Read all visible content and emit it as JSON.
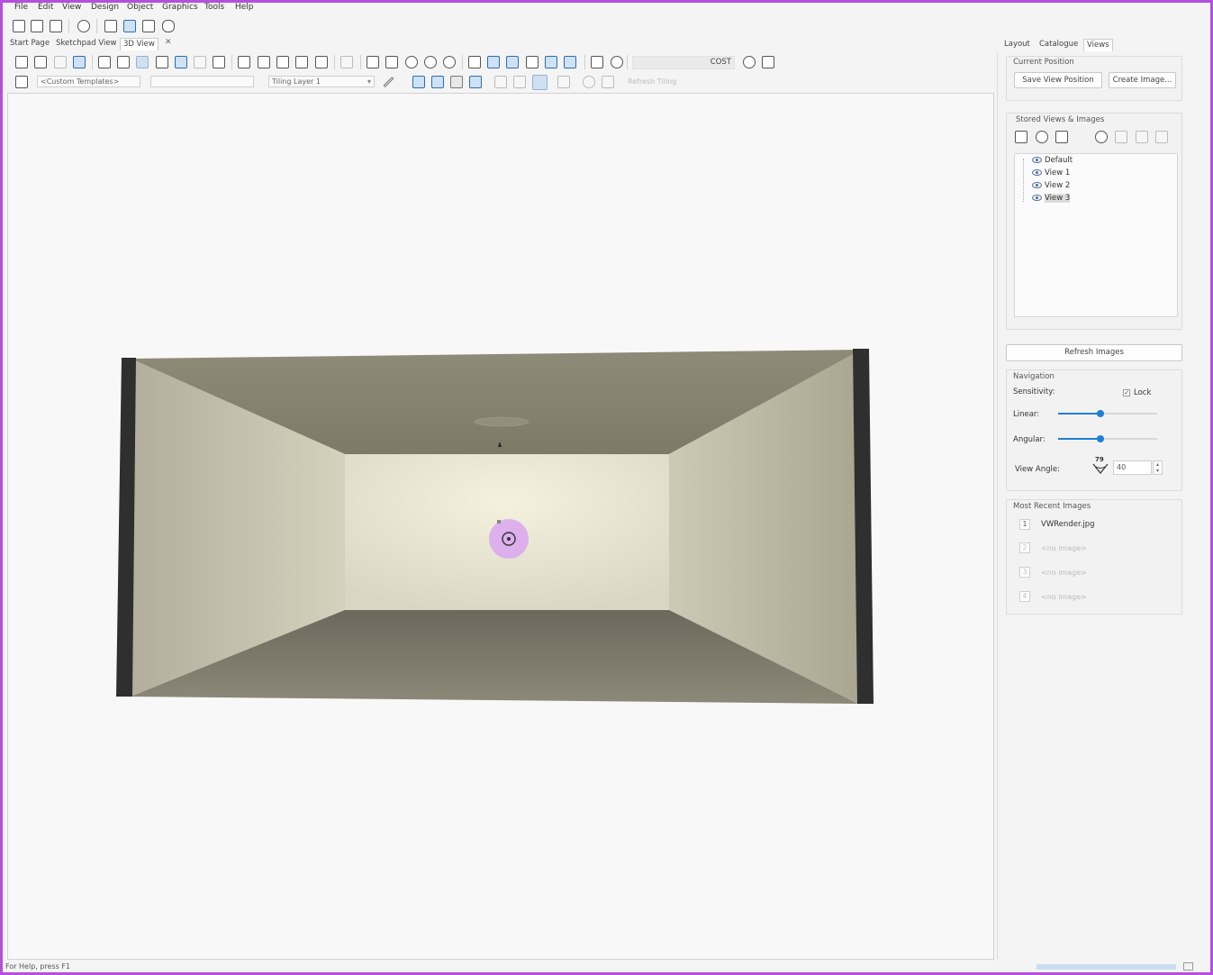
{
  "menu": [
    "File",
    "Edit",
    "View",
    "Design",
    "Object",
    "Graphics",
    "Tools",
    "Help"
  ],
  "doc_tabs": [
    "Start Page",
    "Sketchpad View",
    "3D View"
  ],
  "toolbar": {
    "templates_value": "<Custom Templates>",
    "layer_value": "Tiling Layer 1",
    "cost_label": "COST",
    "refresh_tiling": "Refresh Tiling"
  },
  "right_tabs": [
    "Layout",
    "Catalogue",
    "Views"
  ],
  "current_position": {
    "label": "Current Position",
    "save_button": "Save View Position",
    "create_button": "Create Image..."
  },
  "stored_views": {
    "label": "Stored Views & Images",
    "items": [
      "Default",
      "View 1",
      "View 2",
      "View 3"
    ],
    "selected": "View 3"
  },
  "refresh_images": "Refresh Images",
  "navigation": {
    "label": "Navigation",
    "sensitivity_label": "Sensitivity:",
    "lock_label": "Lock",
    "lock_checked": true,
    "linear_label": "Linear:",
    "linear_level": 0.43,
    "angular_label": "Angular:",
    "angular_level": 0.43,
    "view_angle_label": "View Angle:",
    "view_angle_icon_value": "79",
    "view_angle_value": "40"
  },
  "recent_images": {
    "label": "Most Recent Images",
    "items": [
      {
        "num": "1",
        "name": "VWRender.jpg"
      },
      {
        "num": "2",
        "name": "<no image>"
      },
      {
        "num": "3",
        "name": "<no image>"
      },
      {
        "num": "4",
        "name": "<no image>"
      }
    ]
  },
  "status": "For Help, press F1",
  "colors": {
    "frame": "#b44fe0",
    "accent": "#1f7fd4",
    "wall_dark": "#2f2f2f",
    "ceiling": "#8b8775",
    "back_wall": "#ece9d6",
    "floor": "#7d7a6b",
    "cursor_ring": "#d9a6f0"
  }
}
